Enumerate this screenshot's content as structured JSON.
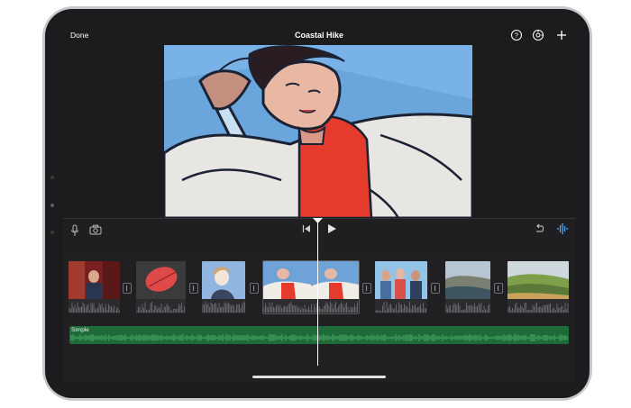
{
  "app": {
    "title": "Coastal Hike",
    "done_label": "Done"
  },
  "toolbar": {
    "icons": [
      "help-icon",
      "settings-icon",
      "add-icon"
    ]
  },
  "controls": {
    "left_icons": [
      "microphone-icon",
      "camera-icon"
    ],
    "center_icons": [
      "skip-to-start-icon",
      "play-icon"
    ],
    "right_icons": [
      "undo-icon",
      "audio-waveform-icon"
    ]
  },
  "timeline": {
    "clips": [
      {
        "subject": "woman in doorway",
        "colors": [
          "#7a1f1f",
          "#c84b3a",
          "#2a3550"
        ]
      },
      {
        "subject": "red leaf",
        "colors": [
          "#3b3b3b",
          "#e0494a",
          "#8a2020"
        ]
      },
      {
        "subject": "woman with sky",
        "colors": [
          "#8fb5e0",
          "#f2e6d8",
          "#3a4560"
        ]
      },
      {
        "subject": "comic-style hiker",
        "colors": [
          "#6fa3d8",
          "#e53b2c",
          "#f0ece6"
        ]
      },
      {
        "subject": "group of friends",
        "colors": [
          "#93c4e8",
          "#d9504b",
          "#4a6ea0"
        ]
      },
      {
        "subject": "coastal rocks",
        "colors": [
          "#b8c6d4",
          "#7a7f72",
          "#3d5560"
        ]
      },
      {
        "subject": "green hills",
        "colors": [
          "#cfd8dc",
          "#5b7a3a",
          "#7ea04a"
        ]
      }
    ],
    "music_track_label": "Simple",
    "accent_color": "#1e6a38"
  }
}
